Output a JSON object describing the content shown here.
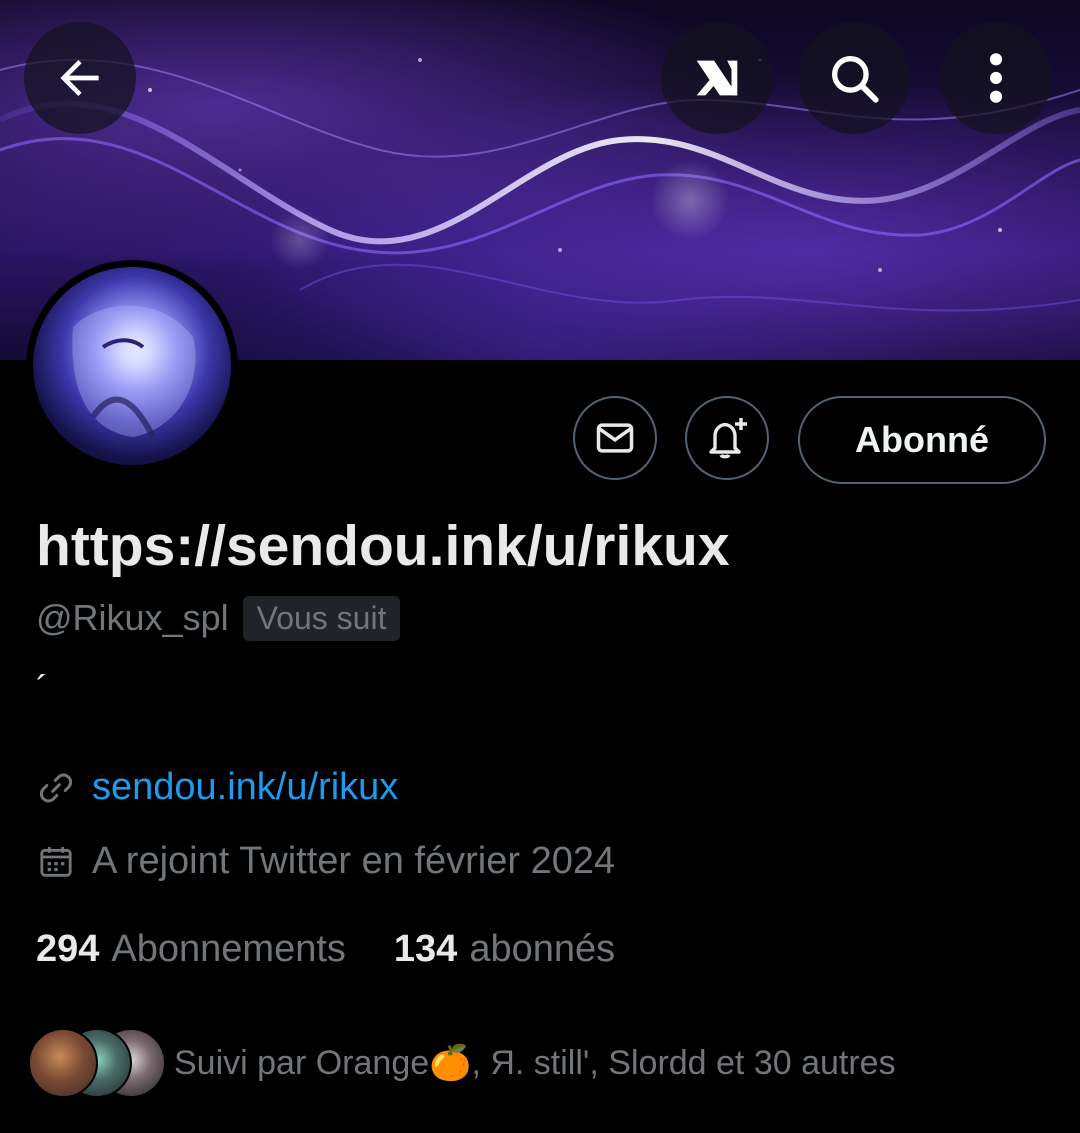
{
  "header": {
    "back_icon": "arrow-left-icon",
    "grok_icon": "grok-icon",
    "search_icon": "search-icon",
    "more_icon": "more-vertical-icon"
  },
  "profile": {
    "display_name": "https://sendou.ink/u/rikux",
    "handle": "@Rikux_spl",
    "follows_you_badge": "Vous suit",
    "bio": "´",
    "website": "sendou.ink/u/rikux",
    "joined": "A rejoint Twitter en février 2024"
  },
  "actions": {
    "message_icon": "mail-icon",
    "notify_icon": "bell-plus-icon",
    "follow_label": "Abonné"
  },
  "stats": {
    "following_count": "294",
    "following_label": "Abonnements",
    "followers_count": "134",
    "followers_label": "abonnés"
  },
  "followed_by": {
    "text": "Suivi par Orange🍊, Я. still', Slordd et 30 autres"
  },
  "colors": {
    "background": "#000000",
    "link": "#1d9bf0",
    "secondary_text": "#71767b",
    "primary_text": "#e7e9ea",
    "border": "#536471"
  }
}
